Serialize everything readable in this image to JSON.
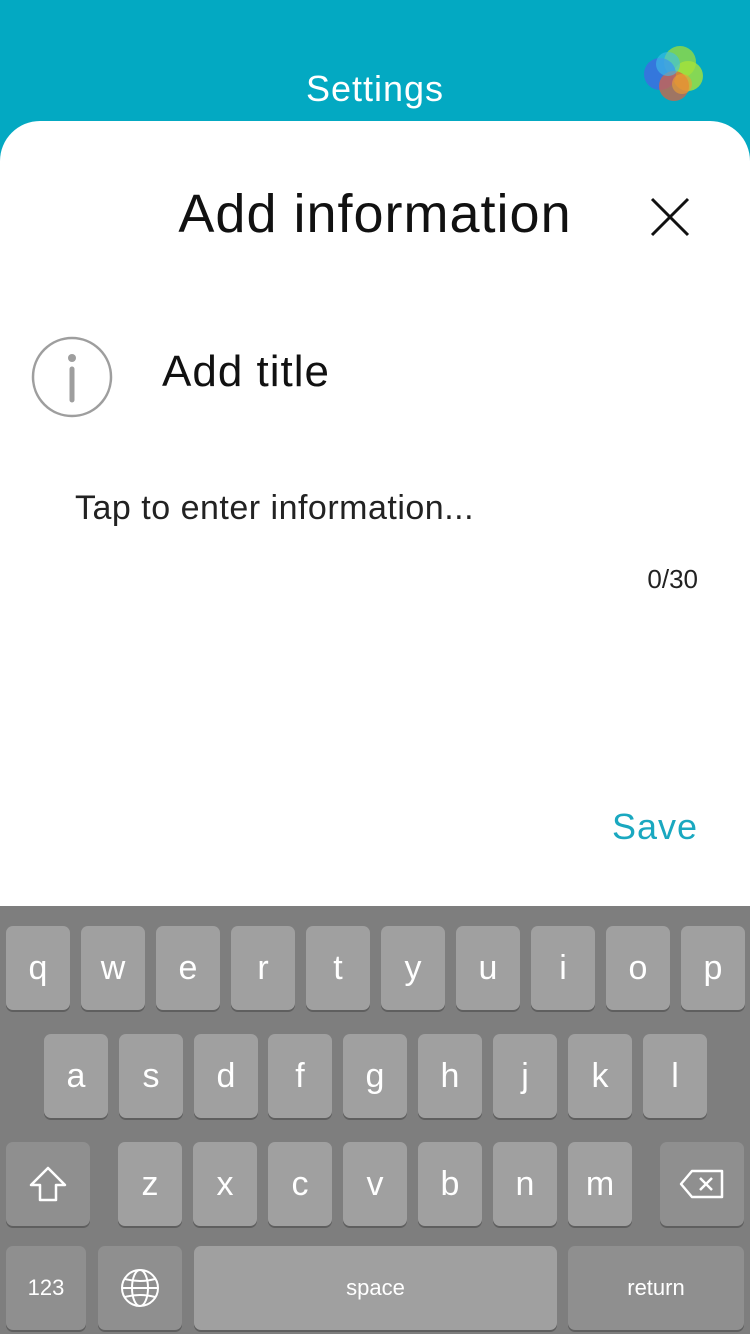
{
  "header": {
    "title": "Settings"
  },
  "dialog": {
    "title": "Add information",
    "add_title_label": "Add title",
    "info_placeholder": "Tap to enter information...",
    "char_counter": "0/30",
    "save_label": "Save"
  },
  "keyboard": {
    "row1": [
      "q",
      "w",
      "e",
      "r",
      "t",
      "y",
      "u",
      "i",
      "o",
      "p"
    ],
    "row2": [
      "a",
      "s",
      "d",
      "f",
      "g",
      "h",
      "j",
      "k",
      "l"
    ],
    "row3": [
      "z",
      "x",
      "c",
      "v",
      "b",
      "n",
      "m"
    ],
    "numbers_label": "123",
    "space_label": "space",
    "return_label": "return"
  },
  "colors": {
    "accent": "#03a9c2",
    "save_text": "#1aa8c0",
    "keyboard_bg": "#7e7e7e",
    "key_bg": "#a0a0a0"
  }
}
